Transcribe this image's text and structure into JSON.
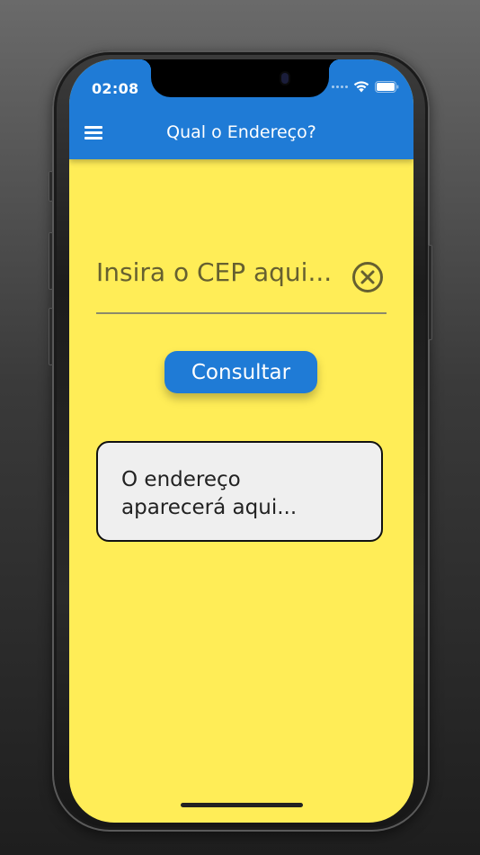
{
  "status_bar": {
    "time": "02:08"
  },
  "app_bar": {
    "title": "Qual o Endereço?",
    "color": "#1f7bd6"
  },
  "cep_field": {
    "placeholder": "Insira o CEP aqui...",
    "value": ""
  },
  "consult_button": {
    "label": "Consultar"
  },
  "result": {
    "text": "O endereço aparecerá aqui..."
  },
  "colors": {
    "background": "#ffed57",
    "accent": "#1f7bd6",
    "result_box": "#efefef"
  },
  "icons": {
    "menu": "menu-icon",
    "clear": "clear-circle-icon",
    "wifi": "wifi-icon",
    "battery": "battery-icon"
  }
}
